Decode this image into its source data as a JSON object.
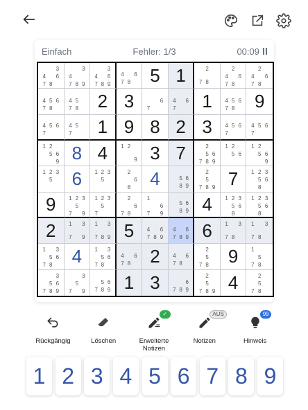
{
  "header": {
    "back_icon": "arrow-left-icon",
    "palette_icon": "palette-icon",
    "export_icon": "open-external-icon",
    "settings_icon": "gear-icon"
  },
  "status": {
    "difficulty": "Einfach",
    "mistakes": "Fehler: 1/3",
    "timer": "00:09"
  },
  "board": {
    "highlight_color": "#eaedf3",
    "selected_color": "#c7d6f8",
    "selected_cell": [
      6,
      5
    ],
    "cells": [
      [
        {
          "n": "3,4,6,7,8"
        },
        {
          "n": "3,4,7,8,9"
        },
        {
          "n": "3,4,6,7,8,9"
        },
        {
          "n": "4,6,7,8"
        },
        {
          "v": "5"
        },
        {
          "v": "1"
        },
        {
          "n": "2,7,8"
        },
        {
          "n": "2,4,6,7,8"
        },
        {
          "n": "2,4,6,7,8"
        }
      ],
      [
        {
          "n": "4,5,6,7,8"
        },
        {
          "n": "4,5,7,8"
        },
        {
          "v": "2"
        },
        {
          "v": "3"
        },
        {
          "n": "6,7"
        },
        {
          "n": "4,6,7"
        },
        {
          "v": "1"
        },
        {
          "n": "4,5,6,7,8"
        },
        {
          "v": "9"
        }
      ],
      [
        {
          "n": "4,5,6,7"
        },
        {
          "n": "4,5,7"
        },
        {
          "v": "1"
        },
        {
          "v": "9"
        },
        {
          "v": "8"
        },
        {
          "v": "2"
        },
        {
          "v": "3"
        },
        {
          "n": "4,5,6,7"
        },
        {
          "n": "4,5,6,7"
        }
      ],
      [
        {
          "n": "1,2,5,6,9"
        },
        {
          "v": "8",
          "c": "blue"
        },
        {
          "v": "4"
        },
        {
          "n": "1,2,9"
        },
        {
          "v": "3"
        },
        {
          "v": "7"
        },
        {
          "n": "2,5,6,7,8,9"
        },
        {
          "n": "1,2,5,6"
        },
        {
          "n": "1,2,5,6,9"
        }
      ],
      [
        {
          "n": "1,2,3,5"
        },
        {
          "v": "6",
          "c": "blue"
        },
        {
          "n": "1,2,3,5"
        },
        {
          "n": "2,6,8"
        },
        {
          "v": "4",
          "c": "blue"
        },
        {
          "n": "5,6,8,9"
        },
        {
          "n": "2,5,7,8,9"
        },
        {
          "v": "7"
        },
        {
          "n": "1,2,3,5,6,8"
        }
      ],
      [
        {
          "v": "9"
        },
        {
          "n": "1,2,3,5,7,9"
        },
        {
          "n": "1,2,3,5,7"
        },
        {
          "n": "2,6,7,8"
        },
        {
          "n": "1,6,7,9"
        },
        {
          "n": "5,6,8,9"
        },
        {
          "v": "4"
        },
        {
          "n": "1,2,3,5,6,8"
        },
        {
          "n": "1,2,3,5,6,8"
        }
      ],
      [
        {
          "v": "2"
        },
        {
          "n": "1,3,7,9"
        },
        {
          "n": "1,3,7,8,9"
        },
        {
          "v": "5"
        },
        {
          "n": "4,6,7,8,9"
        },
        {
          "n": "4,6,7,8,9"
        },
        {
          "v": "6"
        },
        {
          "n": "1,3,7,8"
        },
        {
          "n": "1,3,7,8"
        }
      ],
      [
        {
          "n": "1,3,5,6,7,8"
        },
        {
          "v": "4",
          "c": "blue"
        },
        {
          "n": "1,3,5,6,7,8"
        },
        {
          "n": "4,6,7,8"
        },
        {
          "v": "2"
        },
        {
          "n": "4,6,7,8"
        },
        {
          "n": "2,5,7,8"
        },
        {
          "v": "9"
        },
        {
          "n": "1,5,7,8"
        }
      ],
      [
        {
          "n": "3,5,6,7,8,9"
        },
        {
          "n": "3,5,7,9"
        },
        {
          "n": "5,6,7,8,9"
        },
        {
          "v": "1"
        },
        {
          "v": "3"
        },
        {
          "n": "6,7,8,9"
        },
        {
          "n": "2,5,7,8,9"
        },
        {
          "v": "4"
        },
        {
          "n": "2,5,7,8"
        }
      ]
    ]
  },
  "tools": [
    {
      "id": "undo",
      "label": "Rückgängig",
      "icon": "undo-icon",
      "badge": ""
    },
    {
      "id": "erase",
      "label": "Löschen",
      "icon": "eraser-icon",
      "badge": ""
    },
    {
      "id": "advanced-notes",
      "label": "Erweiterte Notizen",
      "icon": "pencil-notes-icon",
      "badge": "✓"
    },
    {
      "id": "notes",
      "label": "Notizen",
      "icon": "pencil-icon",
      "badge": "AUS"
    },
    {
      "id": "hint",
      "label": "Hinweis",
      "icon": "lightbulb-icon",
      "badge": "99"
    }
  ],
  "numpad": [
    "1",
    "2",
    "3",
    "4",
    "5",
    "6",
    "7",
    "8",
    "9"
  ],
  "colors": {
    "accent": "#3557a8",
    "badge_green": "#2fae4e",
    "badge_blue": "#2e6fe0"
  }
}
